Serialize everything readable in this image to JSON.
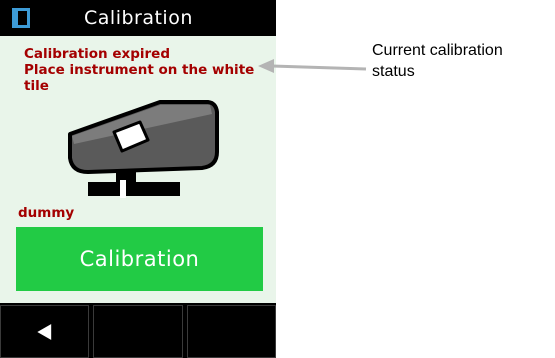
{
  "header": {
    "title": "Calibration",
    "icon": "panel-icon"
  },
  "status": {
    "lines": [
      "Calibration expired",
      "Place instrument on the white",
      "tile"
    ]
  },
  "instrument": {
    "icon": "instrument-on-tile-illustration",
    "name": "dummy"
  },
  "actions": {
    "calibrate_label": "Calibration"
  },
  "softkeys": [
    {
      "icon": "back-triangle-icon"
    },
    {
      "icon": ""
    },
    {
      "icon": ""
    }
  ],
  "annotation": {
    "lines": [
      "Current calibration",
      "status"
    ]
  },
  "colors": {
    "screen_background": "#e9f5ea",
    "bars": "#000000",
    "status_text": "#a40000",
    "calibrate_button": "#22cb45",
    "annotation_arrow": "#b4b4b4"
  }
}
